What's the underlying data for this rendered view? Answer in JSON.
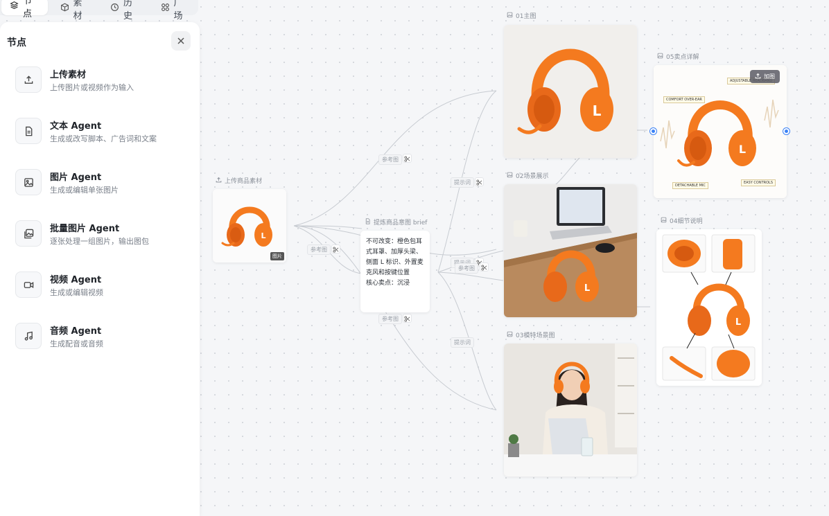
{
  "tabs": [
    {
      "label": "节点",
      "icon": "layers-icon",
      "active": true
    },
    {
      "label": "素材",
      "icon": "cube-icon",
      "active": false
    },
    {
      "label": "历史",
      "icon": "clock-icon",
      "active": false
    },
    {
      "label": "广场",
      "icon": "apps-icon",
      "active": false
    }
  ],
  "panel": {
    "title": "节点",
    "items": [
      {
        "label": "上传素材",
        "desc": "上传图片或视频作为输入",
        "icon": "upload-icon"
      },
      {
        "label": "文本 Agent",
        "desc": "生成或改写脚本、广告词和文案",
        "icon": "document-icon"
      },
      {
        "label": "图片 Agent",
        "desc": "生成或编辑单张图片",
        "icon": "image-icon"
      },
      {
        "label": "批量图片 Agent",
        "desc": "逐张处理一组图片，输出图包",
        "icon": "images-icon"
      },
      {
        "label": "视频 Agent",
        "desc": "生成或编辑视频",
        "icon": "video-icon"
      },
      {
        "label": "音频 Agent",
        "desc": "生成配音或音频",
        "icon": "music-icon"
      }
    ]
  },
  "canvas": {
    "upload_node": {
      "caption": "上传商品素材",
      "badge": "图片"
    },
    "brief_node": {
      "caption": "提炼商品意图 brief",
      "text": "不可改变：橙色包耳式耳罩、加厚头梁、侧面 L 标识、外置麦克风和按键位置\n核心卖点：沉浸"
    },
    "node_01": {
      "caption": "01主图"
    },
    "node_02": {
      "caption": "02场景展示"
    },
    "node_03": {
      "caption": "03模特场景图"
    },
    "node_04": {
      "caption": "04细节说明"
    },
    "node_05": {
      "caption": "05卖点详解",
      "add_label": "加图",
      "callouts": [
        "ADJUSTABLE HEADBAND",
        "COMFORT OVER-EAR",
        "DETACHABLE MIC",
        "EASY CONTROLS"
      ]
    },
    "edge_labels": {
      "ref1": "参考图",
      "ref2": "参考图",
      "ref3": "参考图",
      "ref4": "参考图",
      "prompt1": "提示词",
      "prompt2": "提示词",
      "prompt3": "提示词",
      "prompt4": "提示词"
    }
  },
  "colors": {
    "accent": "#3b82f6",
    "product_orange": "#f47a1f"
  }
}
